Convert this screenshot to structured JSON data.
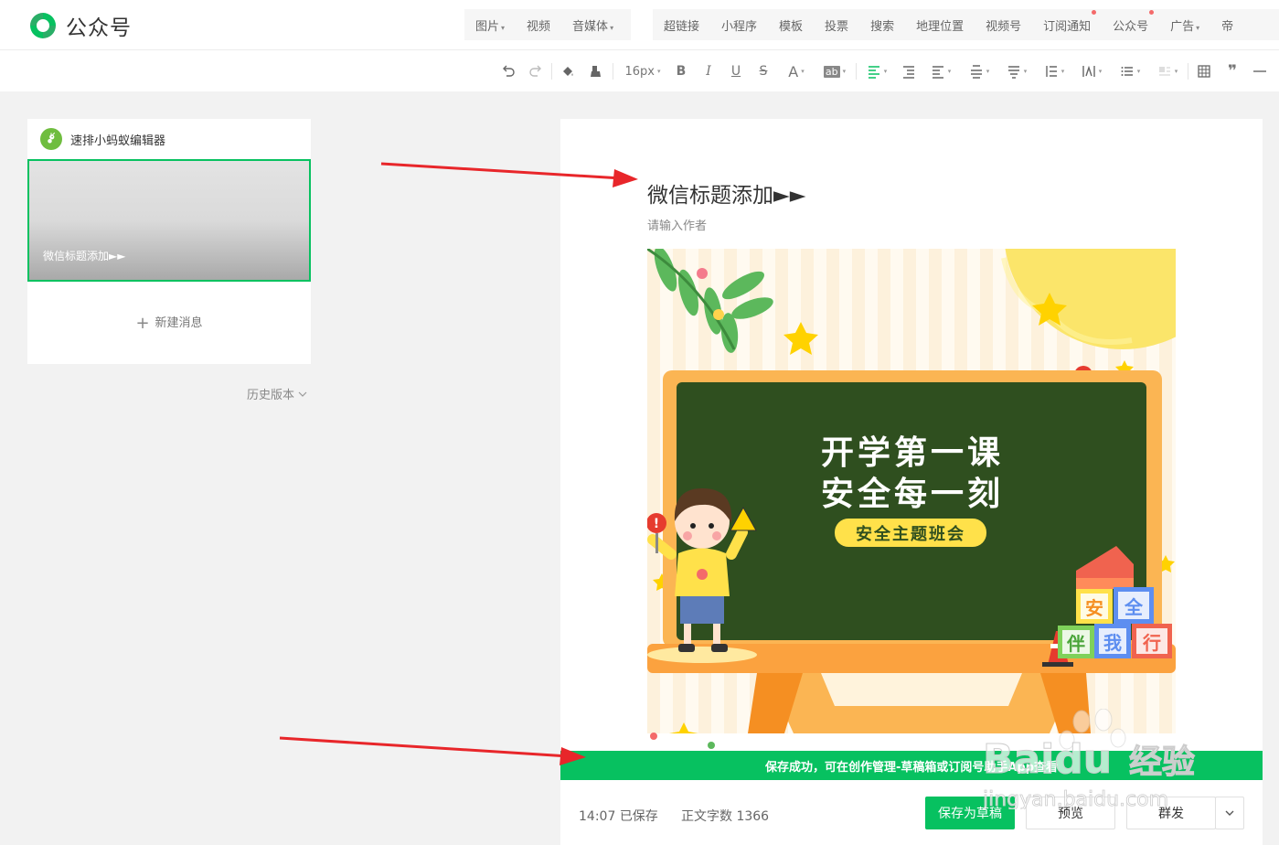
{
  "header": {
    "logo_text": "公众号",
    "insert_group_1": [
      {
        "label": "图片",
        "has_caret": true
      },
      {
        "label": "视频",
        "has_caret": false
      },
      {
        "label": "音媒体",
        "has_caret": true
      }
    ],
    "insert_group_2": [
      {
        "label": "超链接"
      },
      {
        "label": "小程序"
      },
      {
        "label": "模板"
      },
      {
        "label": "投票"
      },
      {
        "label": "搜索"
      },
      {
        "label": "地理位置"
      },
      {
        "label": "视频号"
      },
      {
        "label": "订阅通知"
      },
      {
        "label": "公众号"
      },
      {
        "label": "广告"
      },
      {
        "label": "帝"
      }
    ]
  },
  "toolbar": {
    "font_size": "16px",
    "bold": "B",
    "italic": "I",
    "underline": "U",
    "strike": "S",
    "font_color": "A",
    "highlight": "ab",
    "quote": "❞"
  },
  "sidebar": {
    "account_name": "速排小蚂蚁编辑器",
    "cover_title": "微信标题添加►►",
    "new_message": "新建消息",
    "history": "历史版本"
  },
  "editor": {
    "title": "微信标题添加►►",
    "author_placeholder": "请输入作者"
  },
  "hero_image": {
    "line1": "开学第一课",
    "line2": "安全每一刻",
    "badge": "安全主题班会",
    "blocks": [
      "安",
      "全",
      "伴",
      "我",
      "行"
    ]
  },
  "notice": "保存成功，可在创作管理-草稿箱或订阅号助手App查看",
  "footer": {
    "time": "14:07",
    "saved": "已保存",
    "word_count_label": "正文字数",
    "word_count": "1366",
    "save_draft": "保存为草稿",
    "preview": "预览",
    "publish": "群发"
  },
  "watermark": {
    "brand": "Baidu",
    "brand_cn": "经验",
    "url": "jingyan.baidu.com"
  },
  "colors": {
    "brand_green": "#07c160",
    "arrow_red": "#e8262a"
  }
}
